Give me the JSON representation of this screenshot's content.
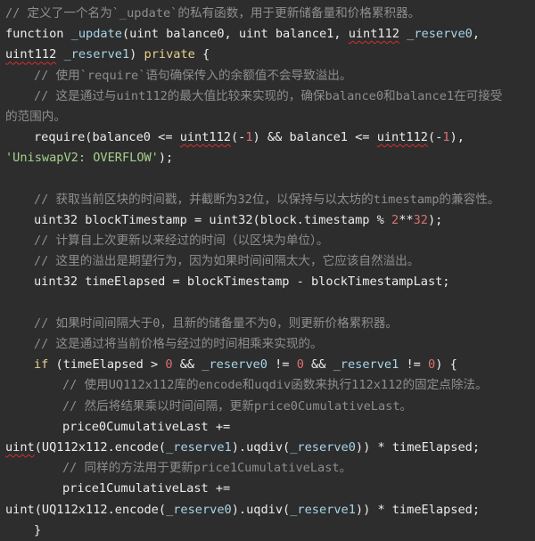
{
  "lines": [
    {
      "indent": 0,
      "tokens": [
        {
          "t": "// 定义了一个名为`_update`的私有函数，用于更新储备量和价格累积器。",
          "k": "c"
        }
      ]
    },
    {
      "indent": 0,
      "tokens": [
        {
          "t": "function ",
          "k": ""
        },
        {
          "t": "_update",
          "k": "fn"
        },
        {
          "t": "(uint balance0, uint balance1, ",
          "k": ""
        },
        {
          "t": "uint112",
          "k": "sq"
        },
        {
          "t": " ",
          "k": ""
        },
        {
          "t": "_reserve0",
          "k": "fn"
        },
        {
          "t": ",",
          "k": ""
        }
      ]
    },
    {
      "indent": 0,
      "tokens": [
        {
          "t": "uint112",
          "k": "sq"
        },
        {
          "t": " ",
          "k": ""
        },
        {
          "t": "_reserve1",
          "k": "fn"
        },
        {
          "t": ") ",
          "k": ""
        },
        {
          "t": "private",
          "k": "kw"
        },
        {
          "t": " {",
          "k": ""
        }
      ]
    },
    {
      "indent": 1,
      "tokens": [
        {
          "t": "// 使用`require`语句确保传入的余额值不会导致溢出。",
          "k": "c"
        }
      ]
    },
    {
      "indent": 1,
      "tokens": [
        {
          "t": "// 这是通过与uint112的最大值比较来实现的，确保balance0和balance1在可接受",
          "k": "c"
        }
      ]
    },
    {
      "indent": 0,
      "tokens": [
        {
          "t": "的范围内。",
          "k": "c"
        }
      ]
    },
    {
      "indent": 1,
      "tokens": [
        {
          "t": "require(balance0 <= ",
          "k": ""
        },
        {
          "t": "uint112",
          "k": "sq"
        },
        {
          "t": "(-",
          "k": ""
        },
        {
          "t": "1",
          "k": "num"
        },
        {
          "t": ") && balance1 <= ",
          "k": ""
        },
        {
          "t": "uint112",
          "k": "sq"
        },
        {
          "t": "(-",
          "k": ""
        },
        {
          "t": "1",
          "k": "num"
        },
        {
          "t": "),",
          "k": ""
        }
      ]
    },
    {
      "indent": 0,
      "tokens": [
        {
          "t": "'UniswapV2: OVERFLOW'",
          "k": "str"
        },
        {
          "t": ");",
          "k": ""
        }
      ]
    },
    {
      "indent": 0,
      "tokens": [
        {
          "t": "",
          "k": ""
        }
      ]
    },
    {
      "indent": 1,
      "tokens": [
        {
          "t": "// 获取当前区块的时间戳，并截断为32位，以保持与以太坊的timestamp的兼容性。",
          "k": "c"
        }
      ]
    },
    {
      "indent": 1,
      "tokens": [
        {
          "t": "uint32 blockTimestamp = uint32(block.timestamp % ",
          "k": ""
        },
        {
          "t": "2",
          "k": "num"
        },
        {
          "t": "**",
          "k": ""
        },
        {
          "t": "32",
          "k": "num"
        },
        {
          "t": ");",
          "k": ""
        }
      ]
    },
    {
      "indent": 1,
      "tokens": [
        {
          "t": "// 计算自上次更新以来经过的时间（以区块为单位）。",
          "k": "c"
        }
      ]
    },
    {
      "indent": 1,
      "tokens": [
        {
          "t": "// 这里的溢出是期望行为，因为如果时间间隔太大，它应该自然溢出。",
          "k": "c"
        }
      ]
    },
    {
      "indent": 1,
      "tokens": [
        {
          "t": "uint32 timeElapsed = blockTimestamp - blockTimestampLast;",
          "k": ""
        }
      ]
    },
    {
      "indent": 0,
      "tokens": [
        {
          "t": "",
          "k": ""
        }
      ]
    },
    {
      "indent": 1,
      "tokens": [
        {
          "t": "// 如果时间间隔大于0，且新的储备量不为0，则更新价格累积器。",
          "k": "c"
        }
      ]
    },
    {
      "indent": 1,
      "tokens": [
        {
          "t": "// 这是通过将当前价格与经过的时间相乘来实现的。",
          "k": "c"
        }
      ]
    },
    {
      "indent": 1,
      "tokens": [
        {
          "t": "if",
          "k": "kw"
        },
        {
          "t": " (timeElapsed > ",
          "k": ""
        },
        {
          "t": "0",
          "k": "num"
        },
        {
          "t": " && ",
          "k": ""
        },
        {
          "t": "_reserve0",
          "k": "fn"
        },
        {
          "t": " != ",
          "k": ""
        },
        {
          "t": "0",
          "k": "num"
        },
        {
          "t": " && ",
          "k": ""
        },
        {
          "t": "_reserve1",
          "k": "fn"
        },
        {
          "t": " != ",
          "k": ""
        },
        {
          "t": "0",
          "k": "num"
        },
        {
          "t": ") {",
          "k": ""
        }
      ]
    },
    {
      "indent": 2,
      "tokens": [
        {
          "t": "// 使用UQ112x112库的encode和uqdiv函数来执行112x112的固定点除法。",
          "k": "c"
        }
      ]
    },
    {
      "indent": 2,
      "tokens": [
        {
          "t": "// 然后将结果乘以时间间隔，更新price0CumulativeLast。",
          "k": "c"
        }
      ]
    },
    {
      "indent": 2,
      "tokens": [
        {
          "t": "price0CumulativeLast +=",
          "k": ""
        }
      ]
    },
    {
      "indent": 0,
      "tokens": [
        {
          "t": "uint",
          "k": "sq"
        },
        {
          "t": "(UQ112x112.encode(",
          "k": ""
        },
        {
          "t": "_reserve1",
          "k": "fn"
        },
        {
          "t": ").uqdiv(",
          "k": ""
        },
        {
          "t": "_reserve0",
          "k": "fn"
        },
        {
          "t": ")) * timeElapsed;",
          "k": ""
        }
      ]
    },
    {
      "indent": 2,
      "tokens": [
        {
          "t": "// 同样的方法用于更新price1CumulativeLast。",
          "k": "c"
        }
      ]
    },
    {
      "indent": 2,
      "tokens": [
        {
          "t": "price1CumulativeLast +=",
          "k": ""
        }
      ]
    },
    {
      "indent": 0,
      "tokens": [
        {
          "t": "uint(UQ112x112.encode(",
          "k": ""
        },
        {
          "t": "_reserve0",
          "k": "fn"
        },
        {
          "t": ").uqdiv(",
          "k": ""
        },
        {
          "t": "_reserve1",
          "k": "fn"
        },
        {
          "t": ")) * timeElapsed;",
          "k": ""
        }
      ]
    },
    {
      "indent": 1,
      "tokens": [
        {
          "t": "}",
          "k": ""
        }
      ]
    }
  ]
}
